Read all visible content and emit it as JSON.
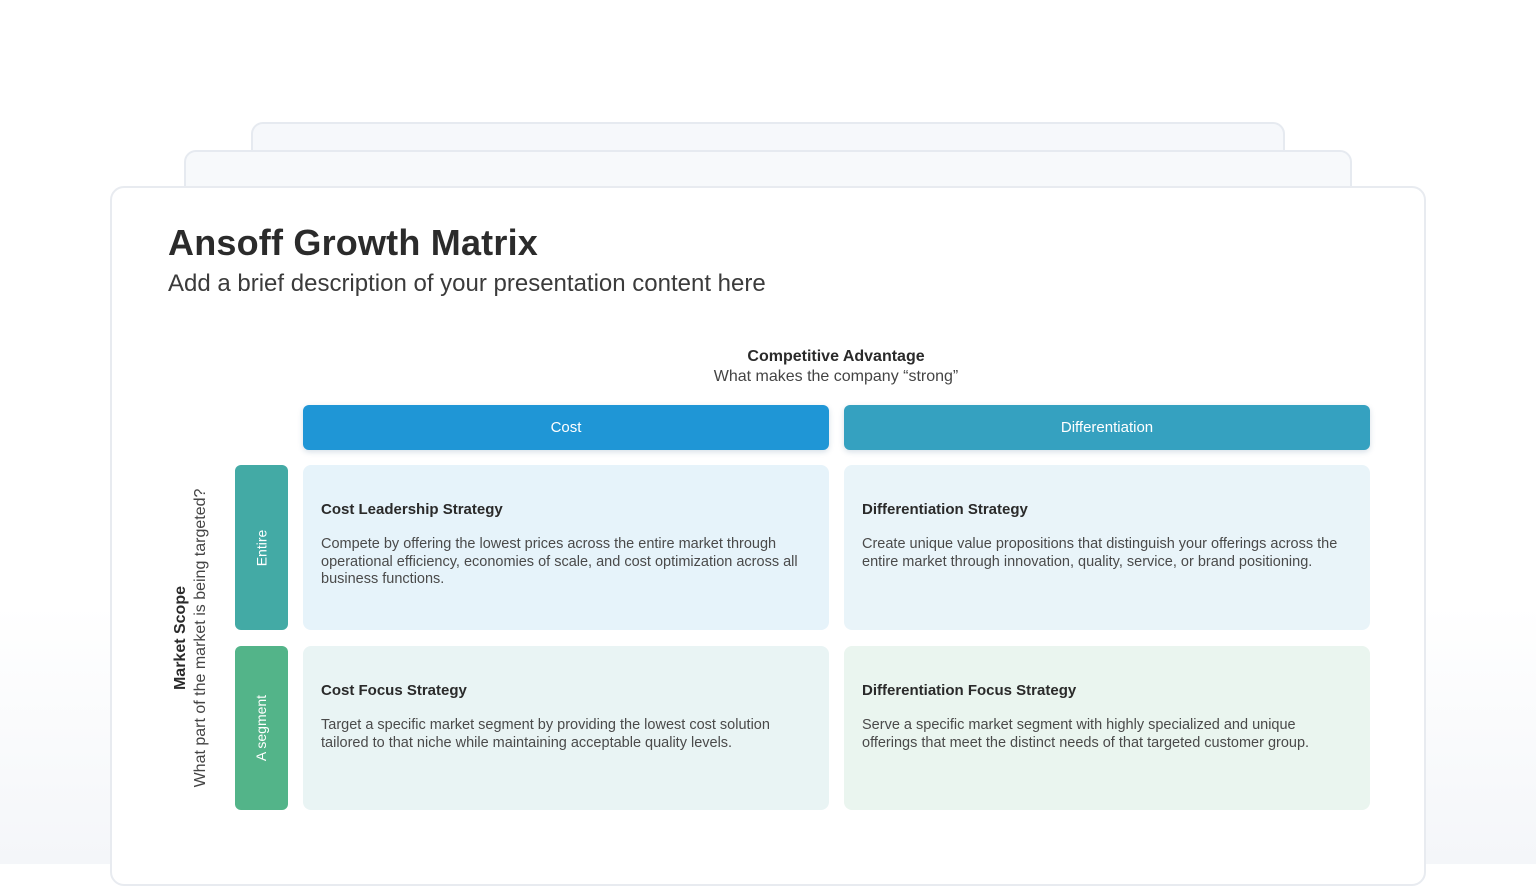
{
  "slide": {
    "title": "Ansoff Growth Matrix",
    "subtitle": "Add a brief description of your presentation content here"
  },
  "matrix": {
    "x_axis": {
      "title": "Competitive Advantage",
      "description": "What makes the company “strong”",
      "columns": [
        "Cost",
        "Differentiation"
      ]
    },
    "y_axis": {
      "title": "Market Scope",
      "description": "What part of the market is being targeted?",
      "rows": [
        "Entire",
        "A segment"
      ]
    },
    "cells": [
      {
        "title": "Cost Leadership Strategy",
        "text": "Compete by offering the lowest prices across the entire market through operational efficiency, economies of scale, and cost optimization across all business functions."
      },
      {
        "title": "Differentiation Strategy",
        "text": "Create unique value propositions that distinguish your offerings across the entire market through innovation, quality, service, or brand positioning."
      },
      {
        "title": "Cost Focus Strategy",
        "text": "Target a specific market segment by providing the lowest cost solution tailored to that niche while maintaining acceptable quality levels."
      },
      {
        "title": "Differentiation Focus Strategy",
        "text": "Serve a specific market segment with highly specialized and unique offerings that meet the distinct needs of that targeted customer group."
      }
    ]
  },
  "colors": {
    "cost_header": "#1f96d6",
    "differentiation_header": "#35a1c0",
    "entire_row": "#43aaa5",
    "segment_row": "#53b489"
  }
}
